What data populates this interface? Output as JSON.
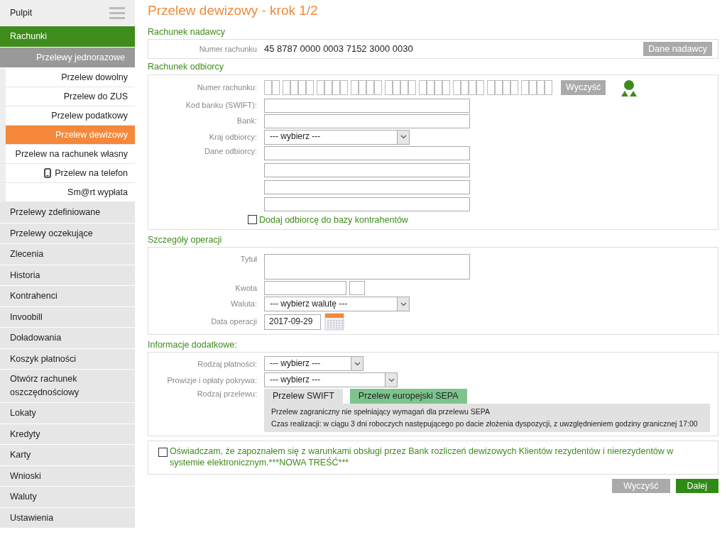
{
  "sidebar": {
    "items": [
      {
        "label": "Pulpit",
        "selected": false,
        "menu_toggle": true
      },
      {
        "label": "Rachunki",
        "selected": true,
        "children": [
          {
            "label": "Przelewy jednorazowe",
            "expanded": true,
            "children": [
              {
                "label": "Przelew dowolny",
                "selected": false
              },
              {
                "label": "Przelew do ZUS",
                "selected": false
              },
              {
                "label": "Przelew podatkowy",
                "selected": false
              },
              {
                "label": "Przelew dewizowy",
                "selected": true
              },
              {
                "label": "Przelew na rachunek własny",
                "selected": false
              },
              {
                "label": "Przelew na telefon",
                "selected": false,
                "icon": true
              },
              {
                "label": "Sm@rt wypłata",
                "selected": false
              }
            ]
          }
        ]
      },
      {
        "label": "Przelewy zdefiniowane",
        "selected": false
      },
      {
        "label": "Przelewy oczekujące",
        "selected": false
      },
      {
        "label": "Zlecenia",
        "selected": false
      },
      {
        "label": "Historia",
        "selected": false
      },
      {
        "label": "Kontrahenci",
        "selected": false
      },
      {
        "label": "Invoobill",
        "selected": false
      },
      {
        "label": "Doładowania",
        "selected": false
      },
      {
        "label": "Koszyk płatności",
        "selected": false
      },
      {
        "label": "Otwórz rachunek oszczędnościowy",
        "selected": false
      },
      {
        "label": "Lokaty",
        "selected": false
      },
      {
        "label": "Kredyty",
        "selected": false
      },
      {
        "label": "Karty",
        "selected": false
      },
      {
        "label": "Wnioski",
        "selected": false
      },
      {
        "label": "Waluty",
        "selected": false
      },
      {
        "label": "Ustawienia",
        "selected": false
      }
    ]
  },
  "page_title": "Przelew dewizowy - krok 1/2",
  "sender": {
    "heading": "Rachunek nadawcy",
    "label": "Numer rachunku",
    "account": "45 8787 0000 0003 7152 3000 0030",
    "button": "Dane nadawcy"
  },
  "recipient": {
    "heading": "Rachunek odbiorcy",
    "fields": [
      {
        "kind": "account",
        "label": "Numer rachunku:",
        "clear_button": "Wyczyść"
      },
      {
        "kind": "text",
        "label": "Kod banku (SWIFT):"
      },
      {
        "kind": "text",
        "label": "Bank:"
      },
      {
        "kind": "select",
        "label": "Kraj odbiorcy:",
        "value": "--- wybierz ---"
      },
      {
        "kind": "address",
        "label": "Dane odbiorcy:"
      }
    ],
    "checkbox": {
      "label": "Dodaj odbiorcę do bazy kontrahentów",
      "checked": false
    }
  },
  "details": {
    "heading": "Szczegóły operacji",
    "fields": [
      {
        "kind": "textarea",
        "label": "Tytuł"
      },
      {
        "kind": "amount",
        "label": "Kwota"
      },
      {
        "kind": "select",
        "label": "Waluta:",
        "value": "--- wybierz walutę ---"
      },
      {
        "kind": "date",
        "label": "Data operacji",
        "value": "2017-09-29"
      }
    ]
  },
  "extra": {
    "heading": "Informacje dodatkowe:",
    "fields": [
      {
        "kind": "select",
        "label": "Rodzaj płatności:",
        "value": "--- wybierz ---"
      },
      {
        "kind": "select_wide",
        "label": "Prowizje i opłaty pokrywa:",
        "value": "--- wybierz ---"
      }
    ],
    "transfer_type": {
      "label": "Rodzaj przelewu:",
      "tabs": [
        {
          "label": "Przelew SWIFT",
          "selected": true
        },
        {
          "label": "Przelew europejski SEPA",
          "selected": false
        }
      ],
      "panel_lines": [
        "Przelew zagraniczny nie spełniający wymagań dla przelewu SEPA",
        "Czas realizacji: w ciągu 3 dni roboczych następującego po dacie złożenia dyspozycji, z uwzględnieniem godziny granicznej 17:00"
      ]
    }
  },
  "consent": {
    "text": "Oświadczam, że zapoznałem się z warunkami obsługi przez Bank rozliczeń dewizowych Klientów rezydentów i nierezydentów w systemie elektronicznym.***NOWA TREŚĆ***",
    "checked": false
  },
  "buttons": [
    {
      "label": "Wyczyść",
      "kind": "secondary"
    },
    {
      "label": "Dalej",
      "kind": "primary"
    }
  ]
}
